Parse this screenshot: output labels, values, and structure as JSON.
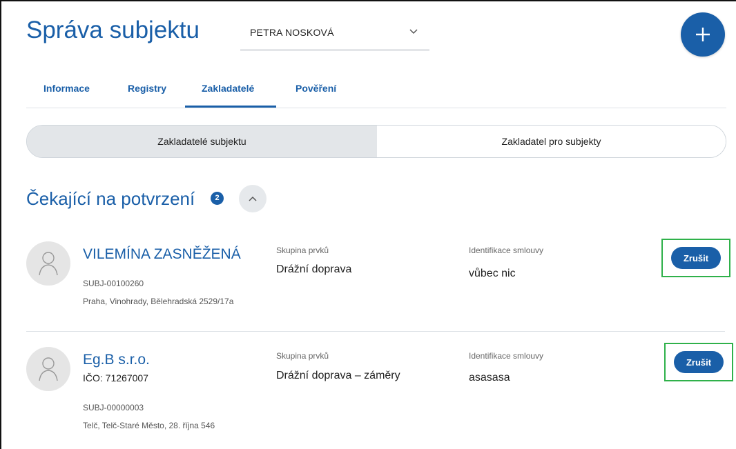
{
  "header": {
    "title": "Správa subjektu",
    "selected_subject": "PETRA NOSKOVÁ",
    "add_icon": "plus-icon"
  },
  "tabs": [
    {
      "label": "Informace"
    },
    {
      "label": "Registry"
    },
    {
      "label": "Zakladatelé"
    },
    {
      "label": "Pověření"
    }
  ],
  "active_tab": "Zakladatelé",
  "segment": {
    "options": [
      "Zakladatelé subjektu",
      "Zakladatel pro subjekty"
    ],
    "selected": "Zakladatelé subjektu"
  },
  "section": {
    "title": "Čekající na potvrzení",
    "count": "2"
  },
  "labels": {
    "group": "Skupina prvků",
    "contract": "Identifikace smlouvy",
    "cancel": "Zrušit"
  },
  "items": [
    {
      "name": "VILEMÍNA ZASNĚŽENÁ",
      "ico": "",
      "subject_id": "SUBJ-00100260",
      "address": "Praha, Vinohrady, Bělehradská 2529/17a",
      "group": "Drážní doprava",
      "contract": "vůbec nic"
    },
    {
      "name": "Eg.B s.r.o.",
      "ico": "IČO: 71267007",
      "subject_id": "SUBJ-00000003",
      "address": "Telč, Telč-Staré Město, 28. října 546",
      "group": "Drážní doprava – záměry",
      "contract": "asasasa"
    }
  ],
  "colors": {
    "primary": "#1a5fa8",
    "highlight": "#2fb14a"
  }
}
